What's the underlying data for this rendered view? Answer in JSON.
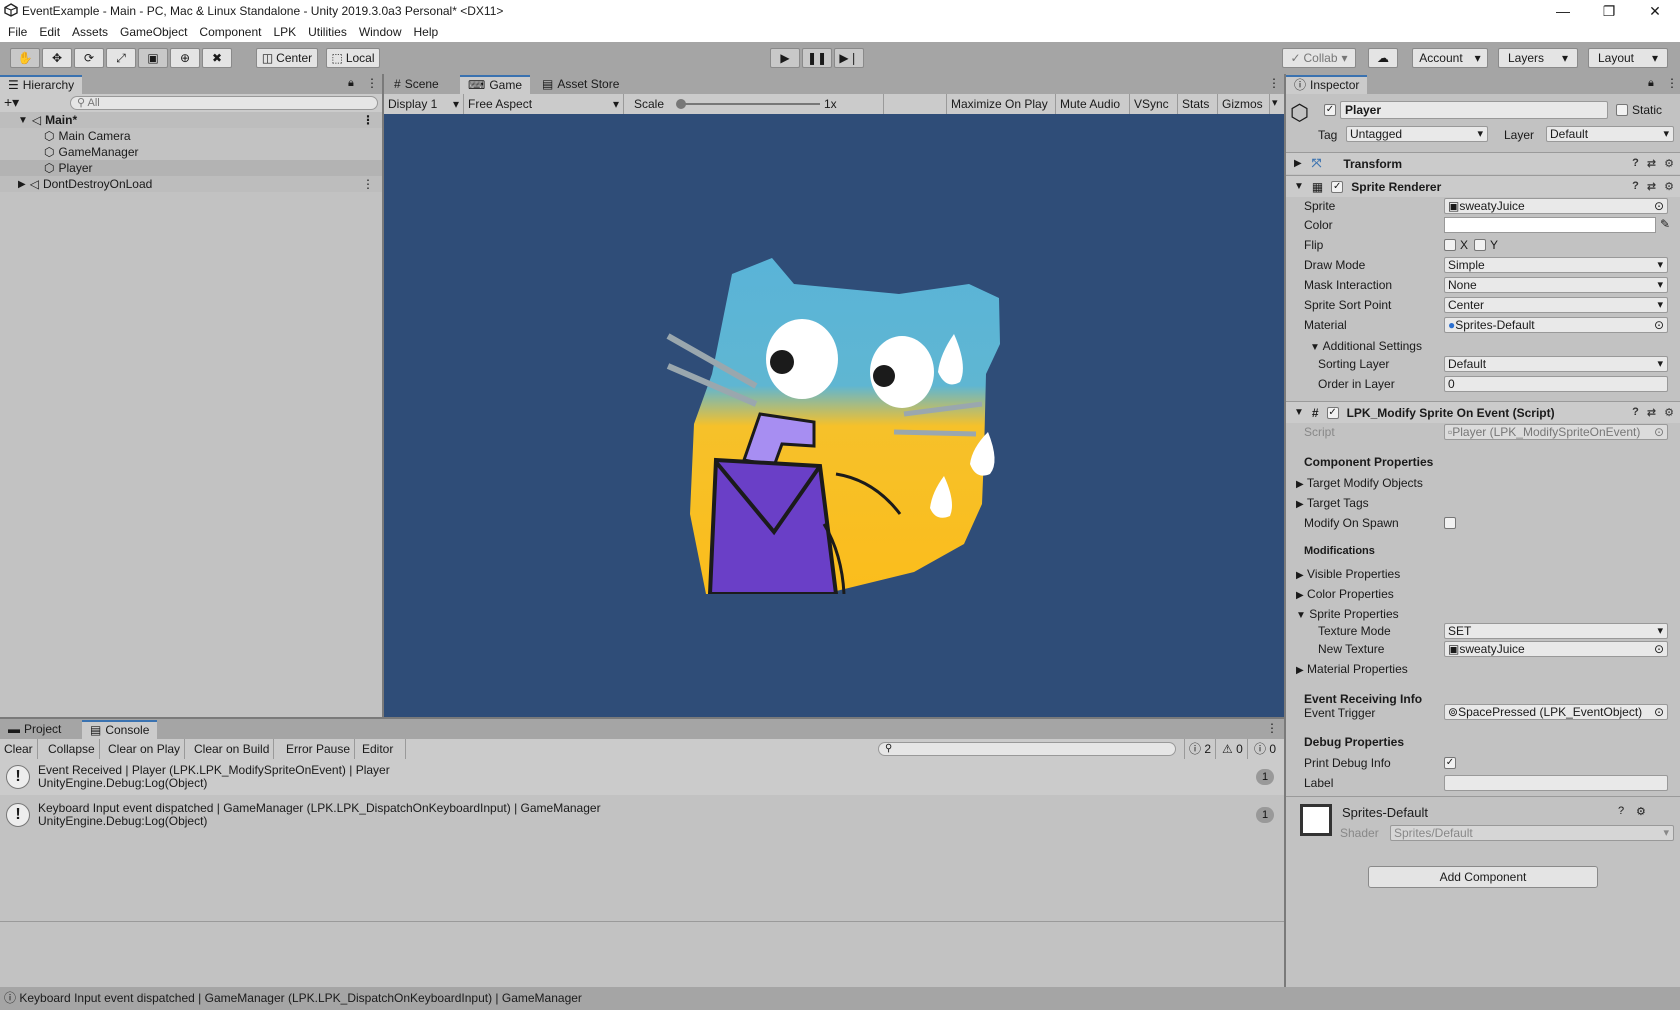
{
  "window": {
    "title": "EventExample - Main - PC, Mac & Linux Standalone - Unity 2019.3.0a3 Personal* <DX11>",
    "controls": [
      "—",
      "❐",
      "✕"
    ]
  },
  "menu": [
    "File",
    "Edit",
    "Assets",
    "GameObject",
    "Component",
    "LPK",
    "Utilities",
    "Window",
    "Help"
  ],
  "toolbar": {
    "pivot": "Center",
    "space": "Local",
    "collab": "Collab",
    "account": "Account",
    "layers": "Layers",
    "layout": "Layout"
  },
  "hierarchy": {
    "tab": "Hierarchy",
    "search_placeholder": "All",
    "items": [
      {
        "label": "Main*"
      },
      {
        "label": "Main Camera"
      },
      {
        "label": "GameManager"
      },
      {
        "label": "Player"
      },
      {
        "label": "DontDestroyOnLoad"
      }
    ]
  },
  "center": {
    "tabs": [
      "Scene",
      "Game",
      "Asset Store"
    ],
    "display": "Display 1",
    "aspect": "Free Aspect",
    "scale_label": "Scale",
    "scale_value": "1x",
    "options": [
      "Maximize On Play",
      "Mute Audio",
      "VSync",
      "Stats",
      "Gizmos"
    ]
  },
  "inspector": {
    "tab": "Inspector",
    "object_name": "Player",
    "static_label": "Static",
    "tag_label": "Tag",
    "tag_value": "Untagged",
    "layer_label": "Layer",
    "layer_value": "Default",
    "transform": "Transform",
    "sprite_renderer": {
      "title": "Sprite Renderer",
      "sprite_label": "Sprite",
      "sprite_value": "sweatyJuice",
      "color_label": "Color",
      "flip_label": "Flip",
      "flip_x": "X",
      "flip_y": "Y",
      "draw_mode_label": "Draw Mode",
      "draw_mode_value": "Simple",
      "mask_label": "Mask Interaction",
      "mask_value": "None",
      "sort_point_label": "Sprite Sort Point",
      "sort_point_value": "Center",
      "material_label": "Material",
      "material_value": "Sprites-Default",
      "additional": "Additional Settings",
      "sorting_layer_label": "Sorting Layer",
      "sorting_layer_value": "Default",
      "order_label": "Order in Layer",
      "order_value": "0"
    },
    "script": {
      "title": "LPK_Modify Sprite On Event (Script)",
      "script_label": "Script",
      "script_value": "Player (LPK_ModifySpriteOnEvent)",
      "component_props": "Component Properties",
      "target_objects": "Target Modify Objects",
      "target_tags": "Target Tags",
      "modify_on_spawn": "Modify On Spawn",
      "modifications": "Modifications",
      "visible_props": "Visible Properties",
      "color_props": "Color Properties",
      "sprite_props": "Sprite Properties",
      "texture_mode_label": "Texture Mode",
      "texture_mode_value": "SET",
      "new_texture_label": "New Texture",
      "new_texture_value": "sweatyJuice",
      "material_props": "Material Properties",
      "event_info": "Event Receiving Info",
      "event_trigger_label": "Event Trigger",
      "event_trigger_value": "SpacePressed (LPK_EventObject)",
      "debug_props": "Debug Properties",
      "print_debug_label": "Print Debug Info",
      "label_label": "Label"
    },
    "material": {
      "name": "Sprites-Default",
      "shader_label": "Shader",
      "shader_value": "Sprites/Default"
    },
    "add_component": "Add Component"
  },
  "console": {
    "tabs": [
      "Project",
      "Console"
    ],
    "buttons": [
      "Clear",
      "Collapse",
      "Clear on Play",
      "Clear on Build",
      "Error Pause",
      "Editor"
    ],
    "counts": {
      "info": "2",
      "warn": "0",
      "error": "0"
    },
    "logs": [
      {
        "line1": "Event Received | Player (LPK.LPK_ModifySpriteOnEvent) | Player",
        "line2": "UnityEngine.Debug:Log(Object)",
        "count": "1"
      },
      {
        "line1": "Keyboard Input event dispatched | GameManager (LPK.LPK_DispatchOnKeyboardInput) | GameManager",
        "line2": "UnityEngine.Debug:Log(Object)",
        "count": "1"
      }
    ]
  },
  "statusbar": "Keyboard Input event dispatched | GameManager (LPK.LPK_DispatchOnKeyboardInput) | GameManager",
  "colors": {
    "game_bg": "#2f4d78",
    "accent": "#3a72b0"
  }
}
